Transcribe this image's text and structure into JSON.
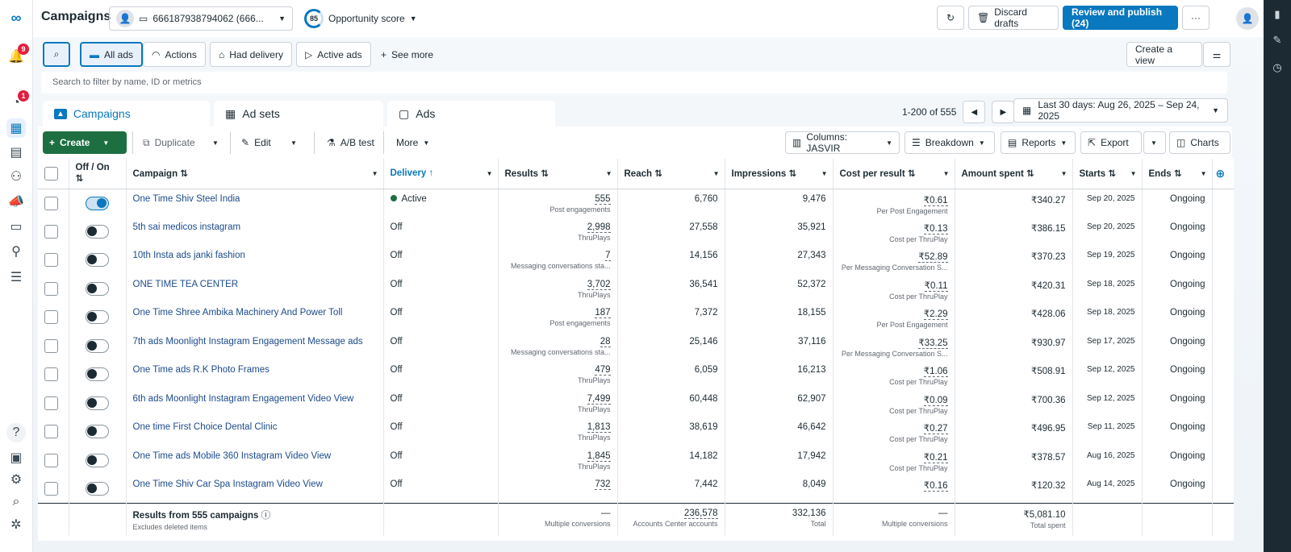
{
  "app": {
    "title": "Campaigns",
    "account": "666187938794062 (666...",
    "opportunity_score": "85",
    "opportunity_label": "Opportunity score",
    "discard_label": "Discard drafts",
    "review_label": "Review and publish (24)",
    "more_label": "···"
  },
  "nav": {
    "notifications_badge": "9",
    "messages_badge": "1"
  },
  "filters": {
    "all_ads": "All ads",
    "actions": "Actions",
    "had_delivery": "Had delivery",
    "active_ads": "Active ads",
    "see_more": "See more",
    "create_view": "Create a view",
    "search_placeholder": "Search to filter by name, ID or metrics"
  },
  "tabs": {
    "campaigns": "Campaigns",
    "ad_sets": "Ad sets",
    "ads": "Ads"
  },
  "pager": {
    "range": "1-200 of 555"
  },
  "date_range": "Last 30 days: Aug 26, 2025 – Sep 24, 2025",
  "toolbar": {
    "create": "Create",
    "duplicate": "Duplicate",
    "edit": "Edit",
    "ab_test": "A/B test",
    "more": "More",
    "columns": "Columns: JASVIR",
    "breakdown": "Breakdown",
    "reports": "Reports",
    "export": "Export",
    "charts": "Charts"
  },
  "columns": {
    "offon": "Off / On",
    "campaign": "Campaign",
    "delivery": "Delivery",
    "results": "Results",
    "reach": "Reach",
    "impressions": "Impressions",
    "cpr": "Cost per result",
    "spent": "Amount spent",
    "starts": "Starts",
    "ends": "Ends"
  },
  "rows": [
    {
      "name": "One Time Shiv Steel India",
      "on": true,
      "delivery": "Active",
      "results": "555",
      "results_sub": "Post engagements",
      "reach": "6,760",
      "impressions": "9,476",
      "cpr": "₹0.61",
      "cpr_sub": "Per Post Engagement",
      "spent": "₹340.27",
      "starts": "Sep 20, 2025",
      "ends": "Ongoing"
    },
    {
      "name": "5th sai medicos instagram",
      "on": false,
      "delivery": "Off",
      "results": "2,998",
      "results_sub": "ThruPlays",
      "reach": "27,558",
      "impressions": "35,921",
      "cpr": "₹0.13",
      "cpr_sub": "Cost per ThruPlay",
      "spent": "₹386.15",
      "starts": "Sep 20, 2025",
      "ends": "Ongoing"
    },
    {
      "name": "10th Insta ads janki fashion",
      "on": false,
      "delivery": "Off",
      "results": "7",
      "results_sub": "Messaging conversations sta...",
      "reach": "14,156",
      "impressions": "27,343",
      "cpr": "₹52.89",
      "cpr_sub": "Per Messaging Conversation S...",
      "spent": "₹370.23",
      "starts": "Sep 19, 2025",
      "ends": "Ongoing"
    },
    {
      "name": "ONE TIME TEA CENTER",
      "on": false,
      "delivery": "Off",
      "results": "3,702",
      "results_sub": "ThruPlays",
      "reach": "36,541",
      "impressions": "52,372",
      "cpr": "₹0.11",
      "cpr_sub": "Cost per ThruPlay",
      "spent": "₹420.31",
      "starts": "Sep 18, 2025",
      "ends": "Ongoing"
    },
    {
      "name": "One Time Shree Ambika Machinery And Power Toll",
      "on": false,
      "delivery": "Off",
      "results": "187",
      "results_sub": "Post engagements",
      "reach": "7,372",
      "impressions": "18,155",
      "cpr": "₹2.29",
      "cpr_sub": "Per Post Engagement",
      "spent": "₹428.06",
      "starts": "Sep 18, 2025",
      "ends": "Ongoing"
    },
    {
      "name": "7th ads Moonlight Instagram Engagement Message ads",
      "on": false,
      "delivery": "Off",
      "results": "28",
      "results_sub": "Messaging conversations sta...",
      "reach": "25,146",
      "impressions": "37,116",
      "cpr": "₹33.25",
      "cpr_sub": "Per Messaging Conversation S...",
      "spent": "₹930.97",
      "starts": "Sep 17, 2025",
      "ends": "Ongoing"
    },
    {
      "name": "One Time ads R.K Photo Frames",
      "on": false,
      "delivery": "Off",
      "results": "479",
      "results_sub": "ThruPlays",
      "reach": "6,059",
      "impressions": "16,213",
      "cpr": "₹1.06",
      "cpr_sub": "Cost per ThruPlay",
      "spent": "₹508.91",
      "starts": "Sep 12, 2025",
      "ends": "Ongoing"
    },
    {
      "name": "6th ads Moonlight Instagram Engagement Video View",
      "on": false,
      "delivery": "Off",
      "results": "7,499",
      "results_sub": "ThruPlays",
      "reach": "60,448",
      "impressions": "62,907",
      "cpr": "₹0.09",
      "cpr_sub": "Cost per ThruPlay",
      "spent": "₹700.36",
      "starts": "Sep 12, 2025",
      "ends": "Ongoing"
    },
    {
      "name": "One time First Choice Dental Clinic",
      "on": false,
      "delivery": "Off",
      "results": "1,813",
      "results_sub": "ThruPlays",
      "reach": "38,619",
      "impressions": "46,642",
      "cpr": "₹0.27",
      "cpr_sub": "Cost per ThruPlay",
      "spent": "₹496.95",
      "starts": "Sep 11, 2025",
      "ends": "Ongoing"
    },
    {
      "name": "One Time ads Mobile 360 Instagram Video View",
      "on": false,
      "delivery": "Off",
      "results": "1,845",
      "results_sub": "ThruPlays",
      "reach": "14,182",
      "impressions": "17,942",
      "cpr": "₹0.21",
      "cpr_sub": "Cost per ThruPlay",
      "spent": "₹378.57",
      "starts": "Aug 16, 2025",
      "ends": "Ongoing"
    },
    {
      "name": "One Time Shiv Car Spa Instagram Video View",
      "on": false,
      "delivery": "Off",
      "results": "732",
      "results_sub": "",
      "reach": "7,442",
      "impressions": "8,049",
      "cpr": "₹0.16",
      "cpr_sub": "",
      "spent": "₹120.32",
      "starts": "Aug 14, 2025",
      "ends": "Ongoing"
    }
  ],
  "totals": {
    "label": "Results from 555 campaigns",
    "sub": "Excludes deleted items",
    "results": "—",
    "results_sub": "Multiple conversions",
    "reach": "236,578",
    "reach_sub": "Accounts Center accounts",
    "impressions": "332,136",
    "impressions_sub": "Total",
    "cpr": "—",
    "cpr_sub": "Multiple conversions",
    "spent": "₹5,081.10",
    "spent_sub": "Total spent"
  },
  "colors": {
    "primary": "#0a78be",
    "create_green": "#1d6f42",
    "badge_red": "#e41e3f"
  }
}
